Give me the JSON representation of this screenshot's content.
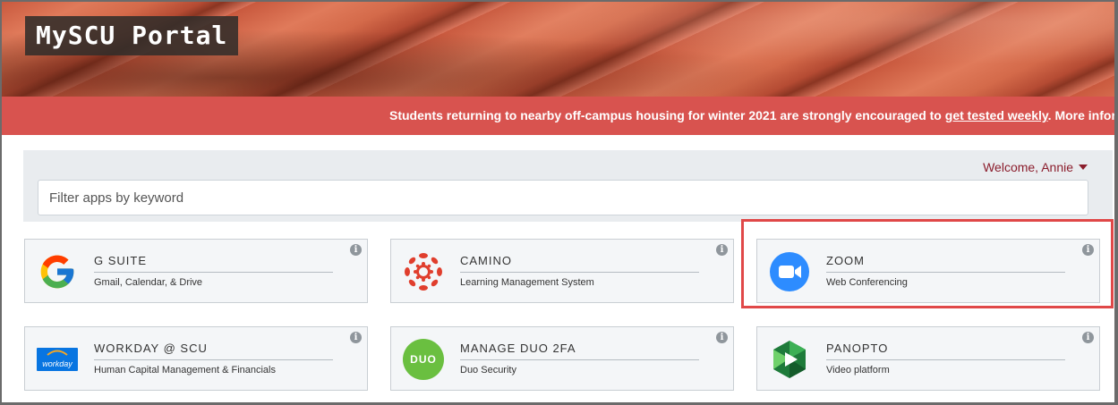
{
  "header": {
    "title": "MySCU Portal"
  },
  "alert": {
    "text_before": "Students returning to nearby off-campus housing for winter 2021 are strongly encouraged to ",
    "link_text": "get tested weekly",
    "text_after": ". More information at"
  },
  "filter": {
    "welcome": "Welcome, Annie",
    "placeholder": "Filter apps by keyword"
  },
  "apps": [
    {
      "name": "G SUITE",
      "description": "Gmail, Calendar, & Drive",
      "icon": "google-g-icon"
    },
    {
      "name": "CAMINO",
      "description": "Learning Management System",
      "icon": "canvas-icon"
    },
    {
      "name": "ZOOM",
      "description": "Web Conferencing",
      "icon": "zoom-camera-icon"
    },
    {
      "name": "WORKDAY @ SCU",
      "description": "Human Capital Management & Financials",
      "icon": "workday-icon",
      "logo_text": "workday"
    },
    {
      "name": "MANAGE DUO 2FA",
      "description": "Duo Security",
      "icon": "duo-icon",
      "logo_text": "DUO"
    },
    {
      "name": "PANOPTO",
      "description": "Video platform",
      "icon": "panopto-icon"
    }
  ],
  "info_symbol": "i",
  "colors": {
    "alert_bg": "#d8534f",
    "welcome_text": "#8b1d2c",
    "highlight": "#e04848",
    "zoom_blue": "#2d8cff",
    "duo_green": "#6abf40"
  }
}
